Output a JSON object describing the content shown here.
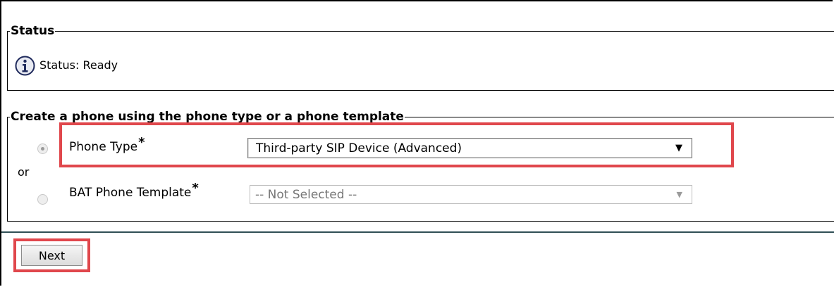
{
  "status_section": {
    "legend": "Status",
    "icon": "info-icon",
    "text": "Status: Ready"
  },
  "create_section": {
    "legend": "Create a phone using the phone type or a phone template",
    "or_text": "or",
    "phone_type": {
      "label": "Phone Type",
      "required_marker": "*",
      "selected": "Third-party SIP Device (Advanced)",
      "radio_checked": true
    },
    "bat_template": {
      "label": "BAT Phone Template",
      "required_marker": "*",
      "selected": "-- Not Selected --",
      "radio_checked": false
    }
  },
  "actions": {
    "next_label": "Next"
  },
  "colors": {
    "highlight": "#e0474c",
    "divider": "#2f4f55"
  }
}
